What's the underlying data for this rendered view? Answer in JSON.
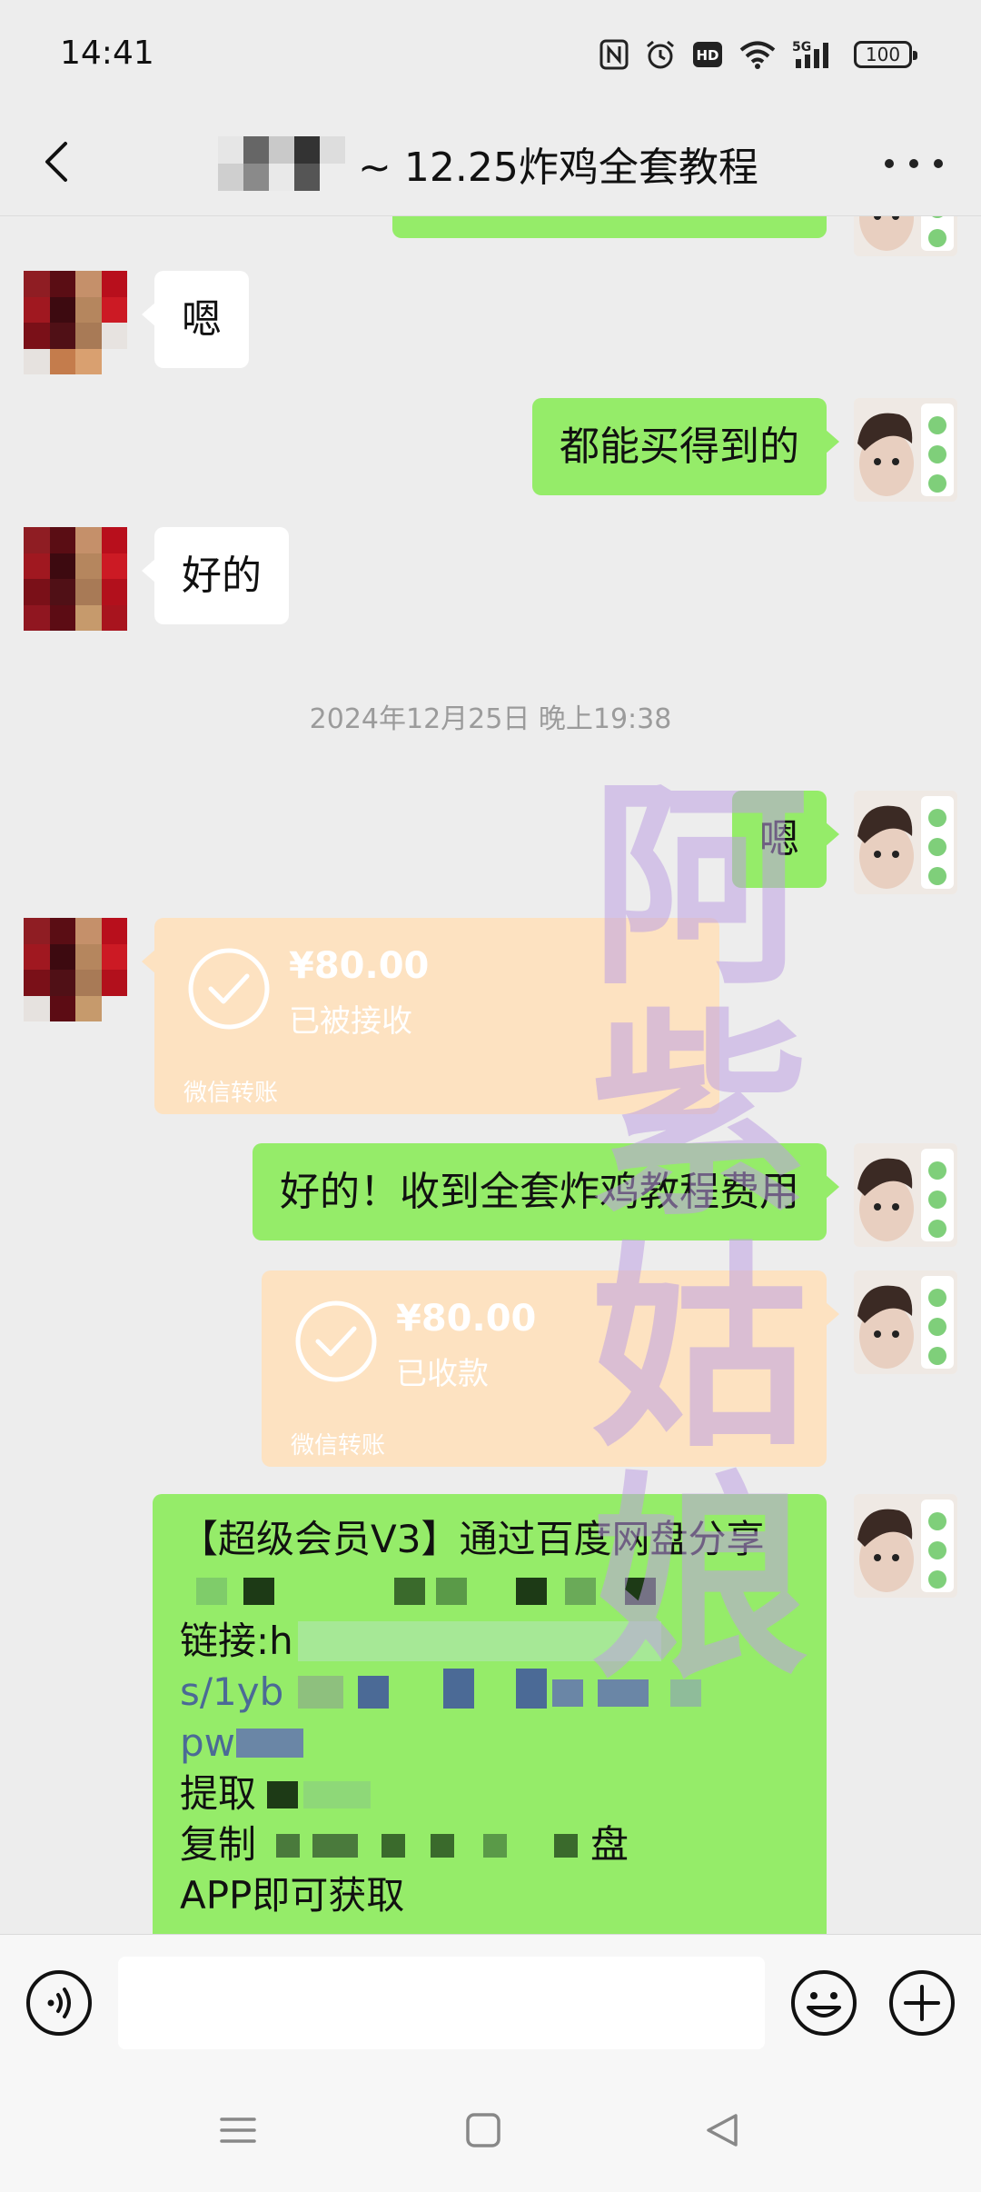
{
  "status_bar": {
    "time": "14:41",
    "icons": [
      "nfc-icon",
      "alarm-icon",
      "hd-icon",
      "wifi-icon",
      "signal-5g-icon"
    ],
    "battery": "100"
  },
  "header": {
    "title": "~ 12.25炸鸡全套教程",
    "back_icon": "chevron-left-icon",
    "more_icon": "more-icon"
  },
  "messages": [
    {
      "side": "left",
      "type": "text",
      "text": "嗯"
    },
    {
      "side": "right",
      "type": "text",
      "text": "都能买得到的"
    },
    {
      "side": "left",
      "type": "text",
      "text": "好的"
    },
    {
      "type": "time",
      "text": "2024年12月25日 晚上19:38"
    },
    {
      "side": "right",
      "type": "text",
      "text": "嗯"
    },
    {
      "side": "left",
      "type": "transfer",
      "amount": "¥80.00",
      "status": "已被接收",
      "footer": "微信转账"
    },
    {
      "side": "right",
      "type": "text",
      "text": "好的！收到全套炸鸡教程费用"
    },
    {
      "side": "right",
      "type": "transfer",
      "amount": "¥80.00",
      "status": "已收款",
      "footer": "微信转账"
    }
  ],
  "share_message": {
    "line1": "【超级会员V3】通过百度网盘分享",
    "line2": "链接:h",
    "line3": "s/1yb",
    "line4": "pw",
    "line5": "提取",
    "line6": "复制",
    "line6_tail": "盘",
    "line7": "APP即可获取"
  },
  "watermark": "阿紫姑娘",
  "input_bar": {
    "placeholder": "",
    "voice_icon": "voice-icon",
    "emoji_icon": "emoji-icon",
    "plus_icon": "plus-icon"
  },
  "nav_bar": [
    "menu-icon",
    "home-icon",
    "back-triangle-icon"
  ],
  "colors": {
    "background": "#ededed",
    "bubble_green": "#95ec69",
    "bubble_white": "#ffffff",
    "transfer_card": "#fde2c1",
    "link_blue": "#4b6a96"
  }
}
